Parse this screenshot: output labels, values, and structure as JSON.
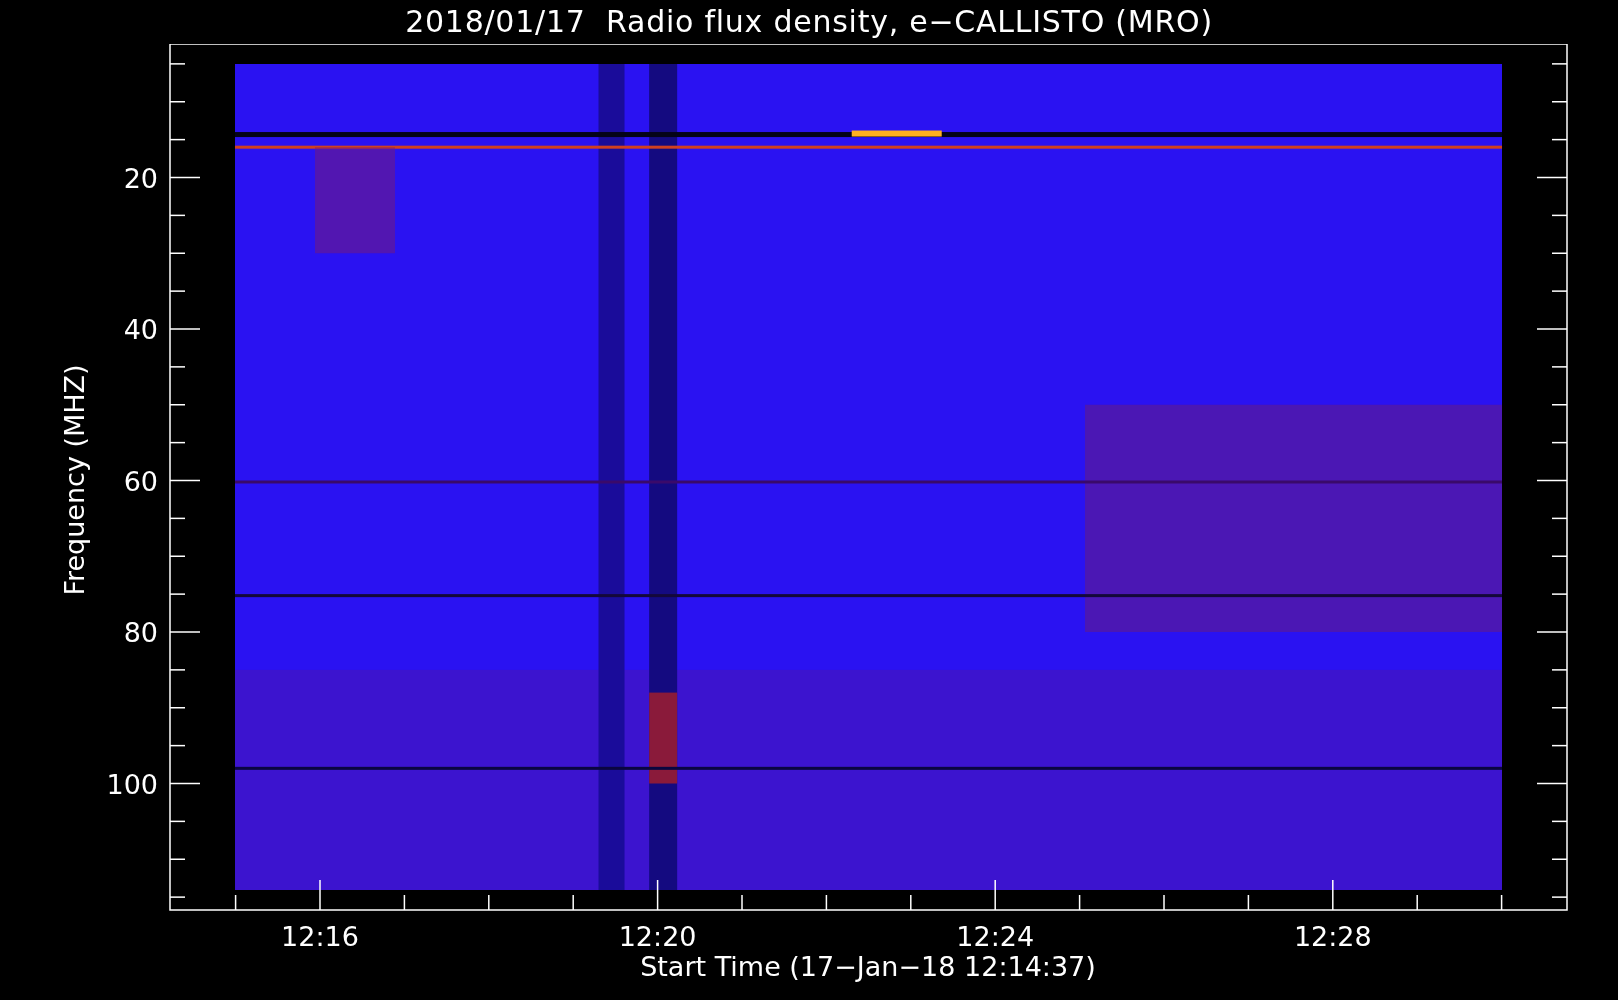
{
  "title": "2018/01/17  Radio flux density, e−CALLISTO (MRO)",
  "y_axis": {
    "label": "Frequency (MHZ)",
    "ticks": [
      "20",
      "40",
      "60",
      "80",
      "100"
    ]
  },
  "x_axis": {
    "label": "Start Time (17−Jan−18 12:14:37)",
    "ticks": [
      "12:16",
      "12:20",
      "12:24",
      "12:28"
    ]
  }
}
